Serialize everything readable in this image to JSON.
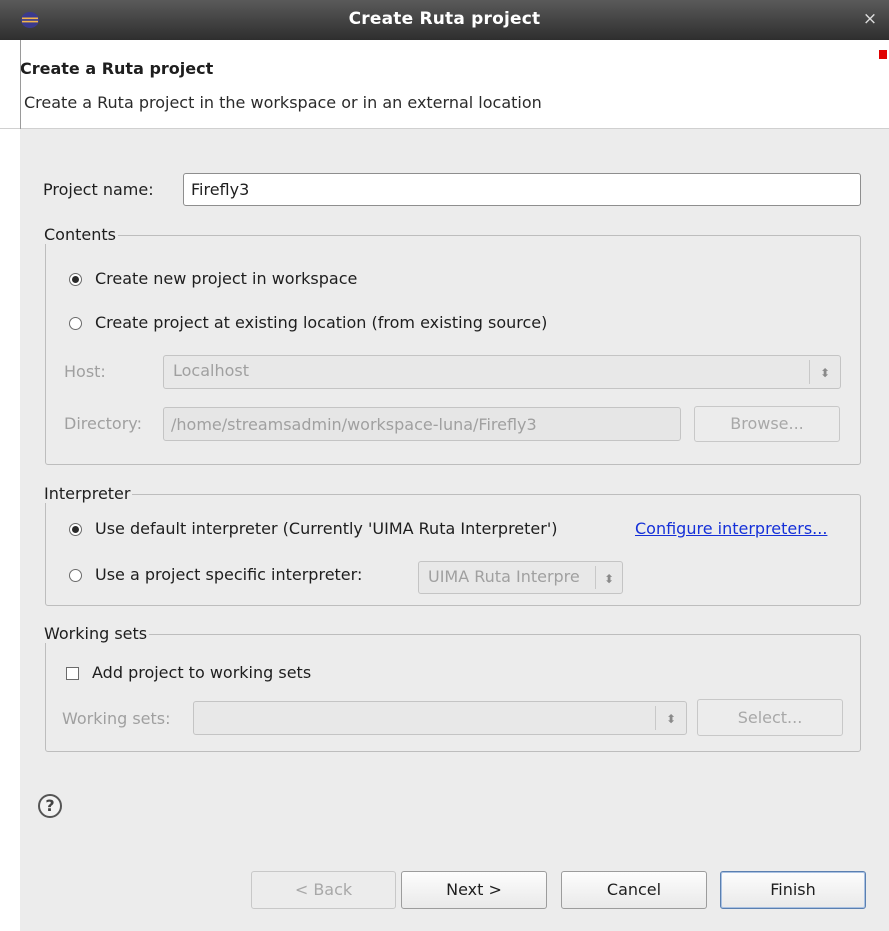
{
  "window": {
    "title": "Create Ruta project",
    "close_glyph": "×",
    "app_icon": "eclipse-icon"
  },
  "header": {
    "title": "Create a Ruta project",
    "description": "Create a Ruta project in the workspace or in an external location"
  },
  "project_name": {
    "label": "Project name:",
    "value": "Firefly3"
  },
  "contents": {
    "label": "Contents",
    "option_new": "Create new project in workspace",
    "option_existing": "Create project at existing location (from existing source)",
    "selected": "new",
    "host_label": "Host:",
    "host_value": "Localhost",
    "directory_label": "Directory:",
    "directory_value": "/home/streamsadmin/workspace-luna/Firefly3",
    "browse_label": "Browse..."
  },
  "interpreter": {
    "label": "Interpreter",
    "option_default": "Use default interpreter (Currently 'UIMA Ruta Interpreter')",
    "configure_link": "Configure interpreters...",
    "option_specific": "Use a project specific interpreter:",
    "specific_value": "UIMA Ruta Interpre",
    "selected": "default"
  },
  "working_sets": {
    "label": "Working sets",
    "add_checkbox": "Add project to working sets",
    "checked": false,
    "sets_label": "Working sets:",
    "sets_value": "",
    "select_label": "Select..."
  },
  "footer": {
    "help_glyph": "?",
    "back_label": "< Back",
    "next_label": "Next >",
    "cancel_label": "Cancel",
    "finish_label": "Finish"
  },
  "colors": {
    "link": "#1530d8",
    "titlebar": "#3a3a3a",
    "panel": "#ececec"
  }
}
